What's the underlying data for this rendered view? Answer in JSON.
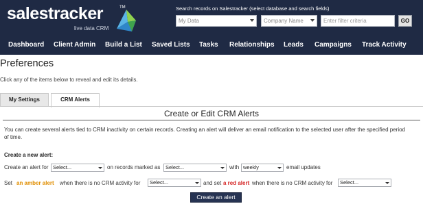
{
  "brand": {
    "name": "salestracker",
    "tm": "TM",
    "tagline": "live data CRM",
    "accent": "#1f2a44"
  },
  "search": {
    "label": "Search records on Salestracker (select database and search fields)",
    "database_value": "My Data",
    "field_value": "Company Name",
    "filter_placeholder": "Enter filter criteria",
    "go_label": "GO"
  },
  "nav": {
    "items": [
      {
        "label": "Dashboard"
      },
      {
        "label": "Client Admin"
      },
      {
        "label": "Build a List"
      },
      {
        "label": "Saved Lists"
      },
      {
        "label": "Tasks"
      },
      {
        "label": "Relationships"
      },
      {
        "label": "Leads"
      },
      {
        "label": "Campaigns"
      },
      {
        "label": "Track Activity"
      }
    ]
  },
  "page": {
    "title": "Preferences",
    "subtitle": "Click any of the items below to reveal and edit its details."
  },
  "tabs": [
    {
      "label": "My Settings",
      "active": false
    },
    {
      "label": "CRM Alerts",
      "active": true
    }
  ],
  "alerts": {
    "title": "Create or Edit CRM Alerts",
    "description": "You can create several alerts tied to CRM inactivity on certain records. Creating an alert will deliver an email notification to the selected user after the specified period of time.",
    "create_label": "Create a new alert:",
    "row1": {
      "prefix": "Create an alert for",
      "user_value": "Select...",
      "middle": "on records marked as",
      "status_value": "Select...",
      "with_text": "with",
      "frequency_value": "weekly",
      "suffix": "email updates"
    },
    "row2": {
      "prefix": "Set an",
      "amber_text": "an amber alert",
      "amber_lead": "Set",
      "after_amber": "when there is no CRM activity for",
      "amber_value": "Select...",
      "and_set": "and set",
      "red_text": "a red alert",
      "after_red": "when there is no CRM activity for",
      "red_value": "Select..."
    },
    "button_label": "Create an alert"
  }
}
